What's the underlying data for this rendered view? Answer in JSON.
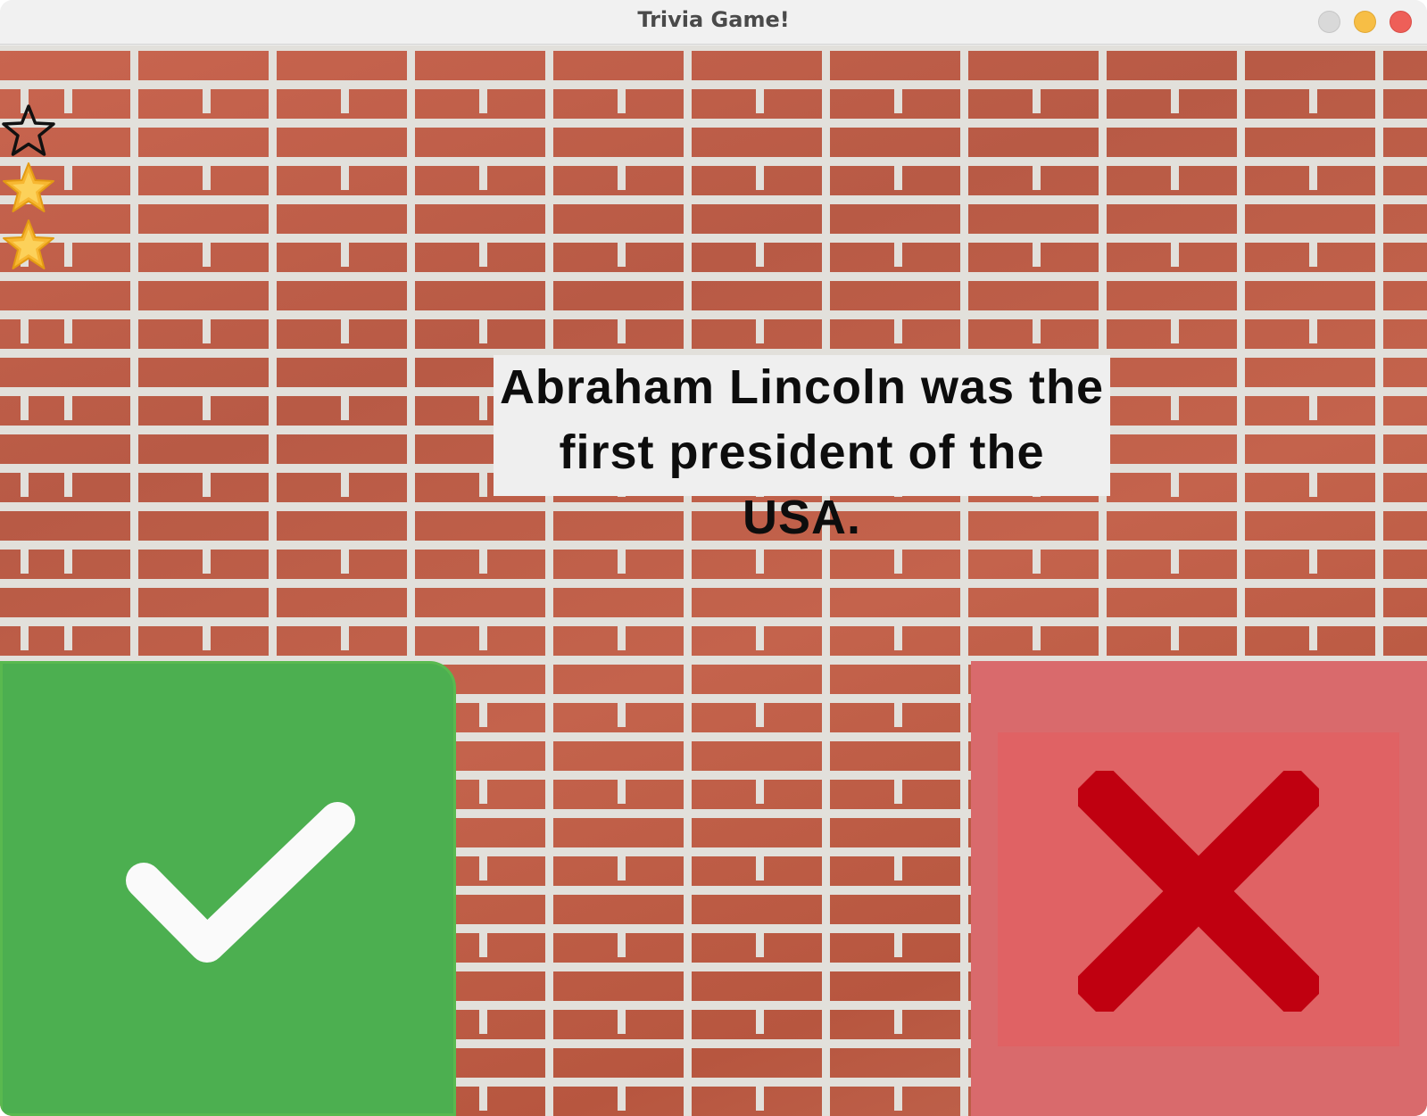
{
  "window": {
    "title": "Trivia Game!"
  },
  "score": {
    "stars": [
      {
        "state": "empty",
        "icon": "star-outline-icon"
      },
      {
        "state": "filled",
        "icon": "star-filled-icon"
      },
      {
        "state": "filled",
        "icon": "star-filled-icon"
      }
    ]
  },
  "question": {
    "text": "Abraham Lincoln was the first president of the USA."
  },
  "answers": {
    "true": {
      "icon": "checkmark-icon",
      "color": "#4caf50"
    },
    "false": {
      "icon": "x-icon",
      "color": "#c00010"
    }
  },
  "colors": {
    "brick": "#c0604a",
    "mortar": "#e2e0db",
    "true_bg": "#4caf50",
    "false_bg": "#d96a6c",
    "false_inner": "#e06264",
    "x_mark": "#c00010",
    "star_fill": "#f7b731"
  }
}
